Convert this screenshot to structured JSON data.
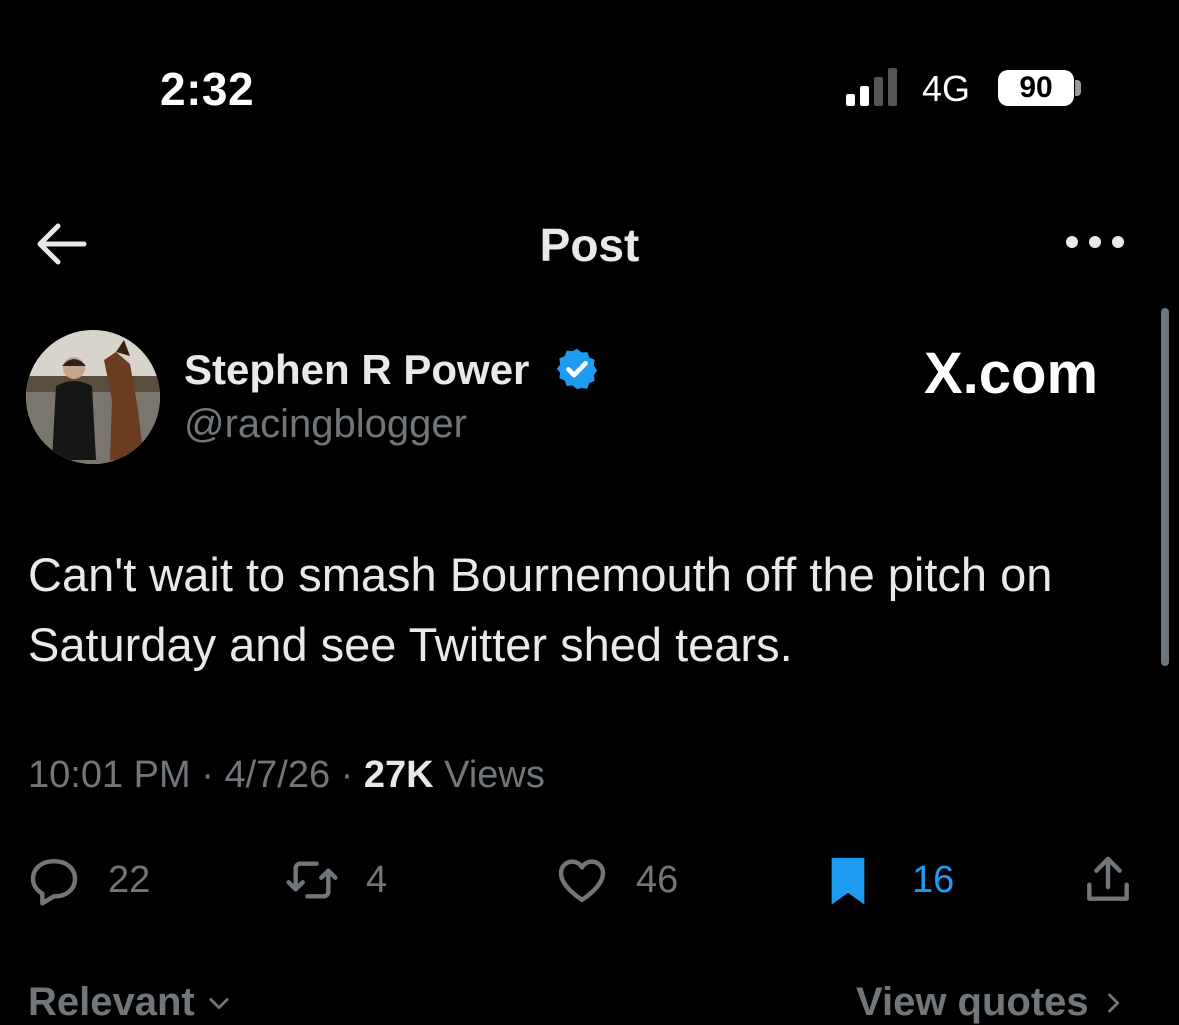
{
  "status_bar": {
    "time": "2:32",
    "network": "4G",
    "battery": "90"
  },
  "nav": {
    "title": "Post",
    "back_icon": "arrow-left-icon",
    "more_icon": "more-dots-icon"
  },
  "author": {
    "display_name": "Stephen R Power",
    "handle": "@racingblogger",
    "verified": true,
    "watermark": "X.com"
  },
  "tweet": {
    "text": "Can't wait to smash Bournemouth off the pitch on Saturday and see Twitter shed tears."
  },
  "meta": {
    "time": "10:01 PM",
    "date": "4/7/26",
    "views_count": "27K",
    "views_label": "Views"
  },
  "actions": {
    "replies": "22",
    "reposts": "4",
    "likes": "46",
    "bookmarks": "16"
  },
  "bottom": {
    "sort_label": "Relevant",
    "quotes_label": "View quotes"
  },
  "colors": {
    "background": "#000000",
    "text": "#e7e9ea",
    "muted": "#71767b",
    "accent": "#1d9bf0"
  }
}
